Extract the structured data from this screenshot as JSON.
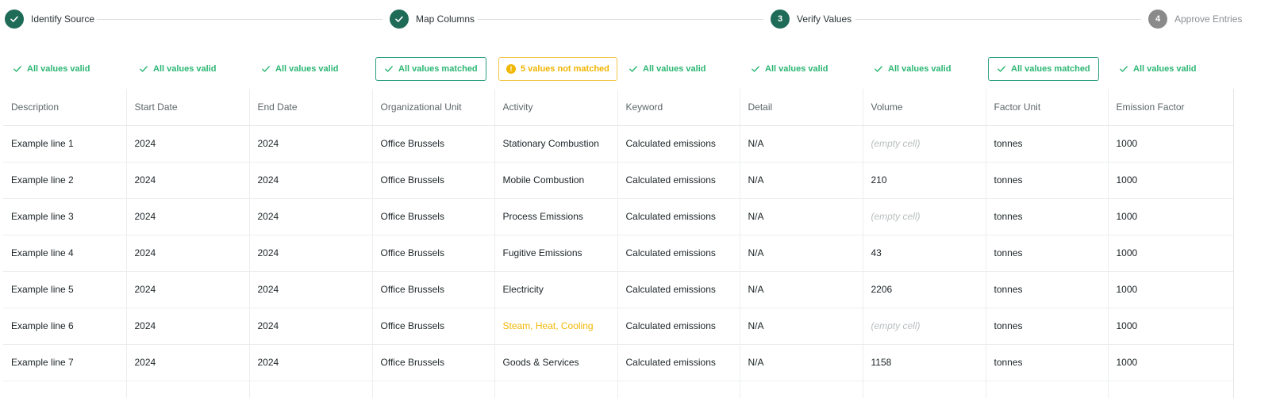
{
  "stepper": {
    "steps": [
      {
        "label": "Identify Source",
        "state": "done",
        "marker": ""
      },
      {
        "label": "Map Columns",
        "state": "done",
        "marker": ""
      },
      {
        "label": "Verify Values",
        "state": "current",
        "marker": "3"
      },
      {
        "label": "Approve Entries",
        "state": "todo",
        "marker": "4"
      }
    ]
  },
  "validation": [
    {
      "text": "All values valid",
      "style": "plain"
    },
    {
      "text": "All values valid",
      "style": "plain"
    },
    {
      "text": "All values valid",
      "style": "plain"
    },
    {
      "text": "All values matched",
      "style": "boxed"
    },
    {
      "text": "5 values not matched",
      "style": "warn"
    },
    {
      "text": "All values valid",
      "style": "plain"
    },
    {
      "text": "All values valid",
      "style": "plain"
    },
    {
      "text": "All values valid",
      "style": "plain"
    },
    {
      "text": "All values matched",
      "style": "boxed"
    },
    {
      "text": "All values valid",
      "style": "plain"
    }
  ],
  "table": {
    "columns": [
      "Description",
      "Start Date",
      "End Date",
      "Organizational Unit",
      "Activity",
      "Keyword",
      "Detail",
      "Volume",
      "Factor Unit",
      "Emission Factor"
    ],
    "rows": [
      [
        "Example line 1",
        "2024",
        "2024",
        "Office Brussels",
        "Stationary Combustion",
        "Calculated emissions",
        "N/A",
        "(empty cell)",
        "tonnes",
        "1000"
      ],
      [
        "Example line 2",
        "2024",
        "2024",
        "Office Brussels",
        "Mobile Combustion",
        "Calculated emissions",
        "N/A",
        "210",
        "tonnes",
        "1000"
      ],
      [
        "Example line 3",
        "2024",
        "2024",
        "Office Brussels",
        "Process Emissions",
        "Calculated emissions",
        "N/A",
        "(empty cell)",
        "tonnes",
        "1000"
      ],
      [
        "Example line 4",
        "2024",
        "2024",
        "Office Brussels",
        "Fugitive Emissions",
        "Calculated emissions",
        "N/A",
        "43",
        "tonnes",
        "1000"
      ],
      [
        "Example line 5",
        "2024",
        "2024",
        "Office Brussels",
        "Electricity",
        "Calculated emissions",
        "N/A",
        "2206",
        "tonnes",
        "1000"
      ],
      [
        "Example line 6",
        "2024",
        "2024",
        "Office Brussels",
        "Steam, Heat, Cooling",
        "Calculated emissions",
        "N/A",
        "(empty cell)",
        "tonnes",
        "1000"
      ],
      [
        "Example line 7",
        "2024",
        "2024",
        "Office Brussels",
        "Goods & Services",
        "Calculated emissions",
        "N/A",
        "1158",
        "tonnes",
        "1000"
      ],
      [
        "",
        "",
        "",
        "",
        "",
        "",
        "",
        "",
        "",
        ""
      ]
    ],
    "unmatched_cells": [
      [
        5,
        4
      ]
    ]
  },
  "colors": {
    "primary": "#1e6b57",
    "valid": "#2bb673",
    "warning": "#f2b705",
    "inactive": "#8a8a8a"
  }
}
